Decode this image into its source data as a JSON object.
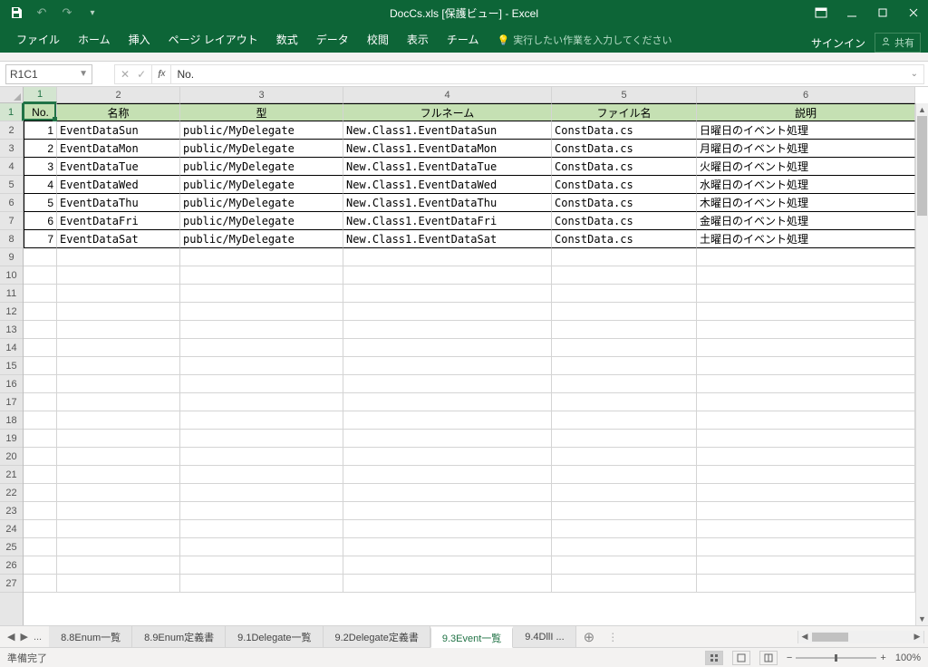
{
  "title": "DocCs.xls  [保護ビュー] - Excel",
  "qat": {
    "undo": "↶",
    "redo": "↷"
  },
  "ribbon": {
    "tabs": [
      "ファイル",
      "ホーム",
      "挿入",
      "ページ レイアウト",
      "数式",
      "データ",
      "校閲",
      "表示",
      "チーム"
    ],
    "tell_me": "実行したい作業を入力してください",
    "signin": "サインイン",
    "share": "共有"
  },
  "namebox": "R1C1",
  "formula": "No.",
  "col_headers": [
    "1",
    "2",
    "3",
    "4",
    "5",
    "6"
  ],
  "row_count": 27,
  "row_headers_start": 1,
  "table": {
    "headers": [
      "No.",
      "名称",
      "型",
      "フルネーム",
      "ファイル名",
      "説明"
    ],
    "rows": [
      [
        "1",
        "EventDataSun",
        "public/MyDelegate",
        "New.Class1.EventDataSun",
        "ConstData.cs",
        "日曜日のイベント処理"
      ],
      [
        "2",
        "EventDataMon",
        "public/MyDelegate",
        "New.Class1.EventDataMon",
        "ConstData.cs",
        "月曜日のイベント処理"
      ],
      [
        "3",
        "EventDataTue",
        "public/MyDelegate",
        "New.Class1.EventDataTue",
        "ConstData.cs",
        "火曜日のイベント処理"
      ],
      [
        "4",
        "EventDataWed",
        "public/MyDelegate",
        "New.Class1.EventDataWed",
        "ConstData.cs",
        "水曜日のイベント処理"
      ],
      [
        "5",
        "EventDataThu",
        "public/MyDelegate",
        "New.Class1.EventDataThu",
        "ConstData.cs",
        "木曜日のイベント処理"
      ],
      [
        "6",
        "EventDataFri",
        "public/MyDelegate",
        "New.Class1.EventDataFri",
        "ConstData.cs",
        "金曜日のイベント処理"
      ],
      [
        "7",
        "EventDataSat",
        "public/MyDelegate",
        "New.Class1.EventDataSat",
        "ConstData.cs",
        "土曜日のイベント処理"
      ]
    ]
  },
  "sheet_tabs": {
    "before": "...",
    "tabs": [
      "8.8Enum一覧",
      "8.9Enum定義書",
      "9.1Delegate一覧",
      "9.2Delegate定義書",
      "9.3Event一覧",
      "9.4DllI ..."
    ],
    "active_index": 4
  },
  "status": {
    "left": "準備完了",
    "zoom": "100%"
  }
}
